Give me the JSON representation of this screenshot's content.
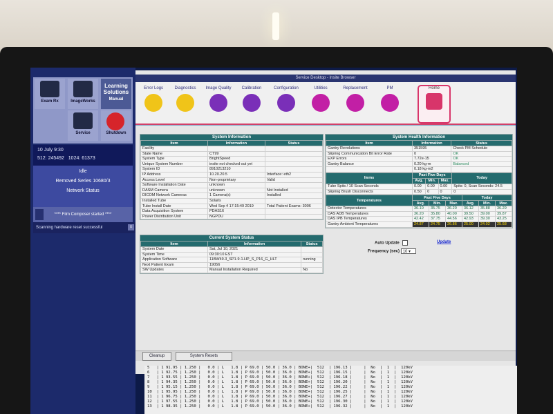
{
  "leftpanel": {
    "tiles": {
      "exam_rx": "Exam Rx",
      "imageworks": "ImageWorks",
      "learning": "Learning Solutions",
      "manual": "Manual",
      "service": "Service",
      "shutdown": "Shutdown"
    },
    "date": "10 July 9:30",
    "stat1_label": "512:",
    "stat1_value": "245492",
    "stat2_label": "1024:",
    "stat2_value": "61373",
    "idle": "Idle",
    "removed_series": "Removed Series 10680/3",
    "network_status": "Network Status",
    "film_composer": "**** Film Composer started ****",
    "message": "Scanning hardware reset successful",
    "close": "x"
  },
  "window": {
    "title": "Service Desktop - Insite Browser",
    "toolbar": [
      {
        "label": "Error Logs",
        "color": "#f0c419"
      },
      {
        "label": "Diagnostics",
        "color": "#f0c419"
      },
      {
        "label": "Image Quality",
        "color": "#7a2fb8"
      },
      {
        "label": "Calibration",
        "color": "#7a2fb8"
      },
      {
        "label": "Configuration",
        "color": "#7a2fb8"
      },
      {
        "label": "Utilities",
        "color": "#c21fa5"
      },
      {
        "label": "Replacement",
        "color": "#c21fa5"
      },
      {
        "label": "PM",
        "color": "#c21fa5"
      },
      {
        "label": "Home",
        "color": "#d8356a"
      }
    ]
  },
  "system_info": {
    "title": "System Information",
    "headers": [
      "Item",
      "Information",
      "Status"
    ],
    "rows": [
      [
        "Facility",
        "",
        ""
      ],
      [
        "State Name",
        "CT99",
        ""
      ],
      [
        "System Type",
        "BrightSpeed",
        ""
      ],
      [
        "Unique System Number",
        "insite not checked out yet",
        ""
      ],
      [
        "System ID",
        "8910213210",
        ""
      ],
      [
        "IP Address",
        "10.20.20.5",
        "Interface: eth2"
      ],
      [
        "Access Level",
        "Non-proprietary",
        "Valid"
      ],
      [
        "Software Installation Date",
        "unknown",
        ""
      ],
      [
        "DASM Camera",
        "unknown",
        "Not Installed"
      ],
      [
        "DICOM Network Cameras",
        "1 Camera(s)",
        "Installed"
      ],
      [
        "Installed Tube",
        "Solaris",
        ""
      ],
      [
        "Tube Install Date",
        "Wed Sep 4 17:15:49 2019",
        "Total Patient Exams: 3006"
      ],
      [
        "Data Acquisition System",
        "PDAS16",
        ""
      ],
      [
        "Power Distribution Unit",
        "NGPDU",
        ""
      ]
    ]
  },
  "current_status": {
    "title": "Current System Status",
    "headers": [
      "Item",
      "Information",
      "Status"
    ],
    "rows": [
      [
        "System Date",
        "Sat, Jul 10, 2021",
        ""
      ],
      [
        "System Time",
        "09:30:10 EST",
        ""
      ],
      [
        "Application Software",
        "11BW49.3_SP1-9-1.HP_S_P16_G_HLT",
        "running"
      ],
      [
        "Next Patient Exam",
        "19056",
        ""
      ],
      [
        "SW Updates",
        "Manual Installation Required",
        "No"
      ]
    ]
  },
  "health_info": {
    "title": "System Health Information",
    "headers": [
      "Item",
      "Information",
      "Status"
    ],
    "rows": [
      [
        "Gantry Revolutions",
        "351595",
        "Check PM Schedule"
      ],
      [
        "Slipring Communication Bit Error Rate",
        "0",
        "OK"
      ],
      [
        "EXP Errors",
        "7.72e-15",
        "OK"
      ],
      [
        "Gantry Balance",
        "0.20 kg-m",
        "Balanced"
      ],
      [
        "",
        "0.18 kg-m2",
        ""
      ]
    ],
    "spits_headers": [
      "Items",
      "Past Five Days",
      "Today"
    ],
    "spits_sub": [
      "Avg.",
      "Min.",
      "Max."
    ],
    "spits_rows": [
      [
        "Tube Spits / 10 Scan Seconds",
        "0.00",
        "0.00",
        "0.00",
        "Spits: 0, Scan Seconds: 24.5"
      ],
      [
        "Slipring Brush Disconnects",
        "0.50",
        "0",
        "0",
        "0"
      ]
    ],
    "temp_headers": [
      "Temperatures",
      "Past Five Days",
      "Today"
    ],
    "temp_sub": [
      "Avg.",
      "Min.",
      "Max.",
      "Avg.",
      "Min.",
      "Max."
    ],
    "temp_rows": [
      [
        "Detector Temperatures",
        "36.10",
        "35.75",
        "36.20",
        "36.12",
        "35.88",
        "36.29"
      ],
      [
        "DAS ADB Temperatures",
        "36.20",
        "35.80",
        "40.00",
        "39.50",
        "39.00",
        "39.87"
      ],
      [
        "DAS IPB Temperatures",
        "42.42",
        "37.75",
        "44.56",
        "42.93",
        "39.30",
        "43.25"
      ],
      [
        "Gantry Ambient Temperatures",
        "24.87",
        "24.75",
        "26.86",
        "25.00",
        "24.02",
        "25.68"
      ]
    ]
  },
  "controls": {
    "auto_update": "Auto Update",
    "update_link": "Update",
    "frequency_label": "Frequency (sec)",
    "frequency_value": "10"
  },
  "bottom": {
    "cleanup": "Cleanup",
    "system_resets": "System Resets"
  },
  "terminal": [
    "5   | 1 91.95 | 1.250 |   0.0 | L   1.8 | P 69.0 | 50.0 | 36.0 | BONE+|  512  | 196.13 |     |  No  |  1  |  120kV",
    "6   | 1 92.75 | 1.250 |   0.0 | L   1.8 | P 69.0 | 50.0 | 36.0 | BONE+|  512  | 196.15 |     |  No  |  1  |  120kV",
    "7   | 1 93.55 | 1.250 |   0.0 | L   1.8 | P 69.0 | 50.0 | 36.0 | BONE+|  512  | 196.18 |     |  No  |  1  |  120kV",
    "8   | 1 94.35 | 1.250 |   0.0 | L   1.8 | P 69.0 | 50.0 | 36.0 | BONE+|  512  | 196.20 |     |  No  |  1  |  120kV",
    "9   | 1 95.15 | 1.250 |   0.0 | L   1.8 | P 69.0 | 50.0 | 36.0 | BONE+|  512  | 196.22 |     |  No  |  1  |  120kV",
    "10  | 1 95.95 | 1.250 |   0.0 | L   1.8 | P 69.0 | 50.0 | 36.0 | BONE+|  512  | 196.25 |     |  No  |  1  |  120kV",
    "11  | 1 96.75 | 1.250 |   0.0 | L   1.8 | P 69.0 | 50.0 | 36.0 | BONE+|  512  | 196.27 |     |  No  |  1  |  120kV",
    "12  | 1 97.55 | 1.250 |   0.0 | L   1.8 | P 69.0 | 50.0 | 36.0 | BONE+|  512  | 196.30 |     |  No  |  1  |  120kV",
    "13  | 1 98.35 | 1.250 |   0.0 | L   1.8 | P 69.0 | 50.0 | 36.0 | BONE+|  512  | 196.32 |     |  No  |  1  |  120kV"
  ]
}
